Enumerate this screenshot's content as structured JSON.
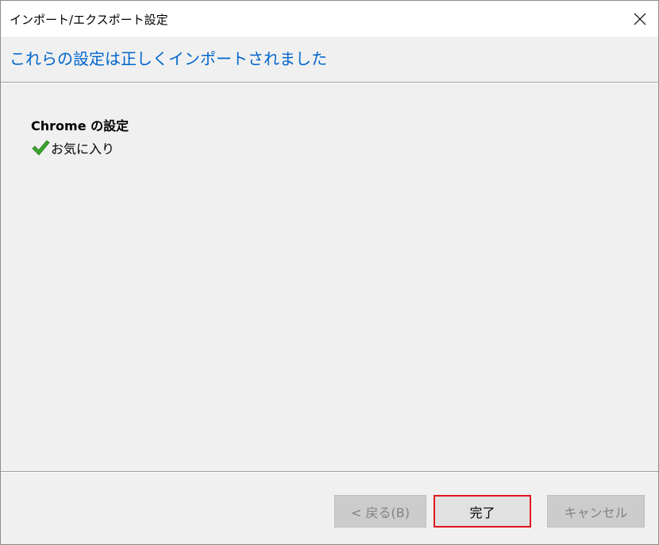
{
  "window": {
    "title": "インポート/エクスポート設定",
    "close_icon": "close-icon"
  },
  "header": {
    "title": "これらの設定は正しくインポートされました"
  },
  "content": {
    "section_heading": "Chrome の設定",
    "results": [
      {
        "icon": "checkmark-icon",
        "label": "お気に入り",
        "status": "success"
      }
    ]
  },
  "buttons": {
    "back_label": "< 戻る(B)",
    "finish_label": "完了",
    "cancel_label": "キャンセル"
  },
  "colors": {
    "header_title": "#0066cc",
    "check_green": "#3aa82a",
    "highlight_border": "#e0141e",
    "dialog_bg": "#f0f0f0"
  }
}
